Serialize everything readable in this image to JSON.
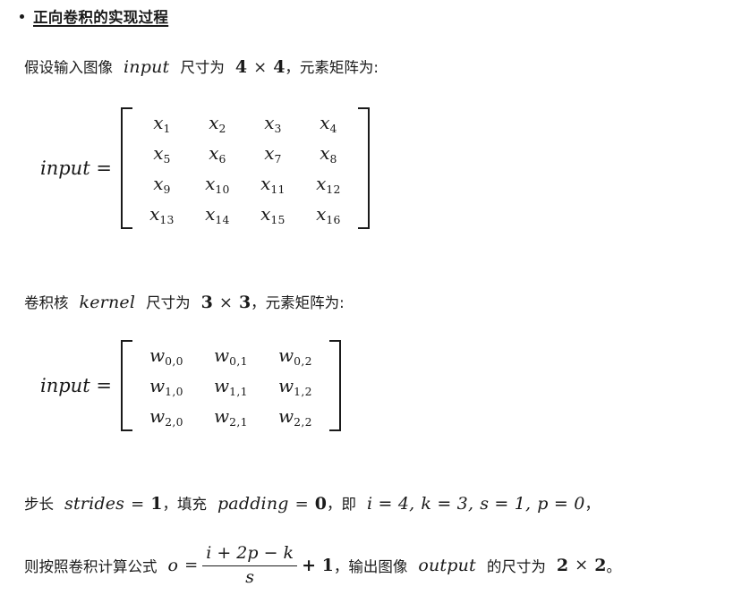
{
  "document": {
    "heading": {
      "bullet": "bullet-point",
      "text": "正向卷积的实现过程"
    },
    "line_input": {
      "prefix": "假设输入图像",
      "var": "input",
      "mid": "尺寸为",
      "dim_a": "4",
      "times": "×",
      "dim_b": "4",
      "comma": "，",
      "suffix": "元素矩阵为:"
    },
    "matrix_input": {
      "label": "input =",
      "rows": [
        [
          "x1",
          "x2",
          "x3",
          "x4"
        ],
        [
          "x5",
          "x6",
          "x7",
          "x8"
        ],
        [
          "x9",
          "x10",
          "x11",
          "x12"
        ],
        [
          "x13",
          "x14",
          "x15",
          "x16"
        ]
      ],
      "base": "x",
      "subs": [
        [
          "1",
          "2",
          "3",
          "4"
        ],
        [
          "5",
          "6",
          "7",
          "8"
        ],
        [
          "9",
          "10",
          "11",
          "12"
        ],
        [
          "13",
          "14",
          "15",
          "16"
        ]
      ]
    },
    "line_kernel": {
      "prefix": "卷积核",
      "var": "kernel",
      "mid": "尺寸为",
      "dim_a": "3",
      "times": "×",
      "dim_b": "3",
      "comma": "，",
      "suffix": "元素矩阵为:"
    },
    "matrix_kernel": {
      "label": "input =",
      "base": "w",
      "subs": [
        [
          "0,0",
          "0,1",
          "0,2"
        ],
        [
          "1,0",
          "1,1",
          "1,2"
        ],
        [
          "2,0",
          "2,1",
          "2,2"
        ]
      ]
    },
    "line_params": {
      "label_strides": "步长",
      "var_strides": "strides",
      "eq1": "=",
      "val_strides": "1",
      "comma1": "，",
      "label_padding": "填充",
      "var_padding": "padding",
      "eq2": "=",
      "val_padding": "0",
      "comma2": "，",
      "label_namely": "即",
      "i_expr": "i = 4,",
      "k_expr": "k = 3,",
      "s_expr": "s = 1,",
      "p_expr": "p = 0",
      "comma3": "，"
    },
    "line_formula": {
      "prefix": "则按照卷积计算公式",
      "o": "o",
      "eq": "=",
      "numerator": "i + 2p − k",
      "denominator": "s",
      "plus_one": "+ 1",
      "comma": "，",
      "mid": "输出图像",
      "var_output": "output",
      "suffix": "的尺寸为",
      "out_a": "2",
      "times": "×",
      "out_b": "2",
      "period": "。"
    }
  },
  "colors": {
    "background": "#ffffff",
    "text": "#1a1a1a"
  }
}
